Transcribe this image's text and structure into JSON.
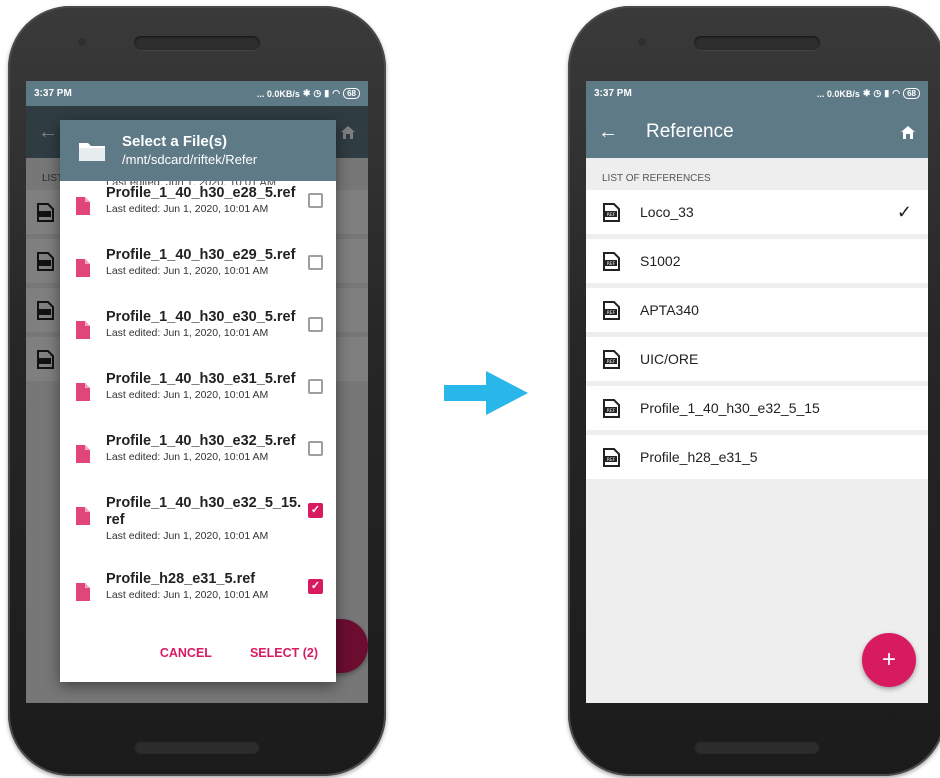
{
  "status_bar": {
    "time": "3:37 PM",
    "net_speed": "... 0.0KB/s",
    "battery": "68"
  },
  "colors": {
    "toolbar": "#5e7a86",
    "accent": "#d81b60",
    "background": "#eeeeee"
  },
  "left_phone": {
    "dialog": {
      "title": "Select a File(s)",
      "path": "/mnt/sdcard/riftek/Refer",
      "partial_row_text": "Last edited: Jun 1, 2020, 10:01 AM",
      "files": [
        {
          "name": "Profile_1_40_h30_e28_5.ref",
          "meta": "Last edited: Jun 1, 2020, 10:01 AM",
          "checked": false
        },
        {
          "name": "Profile_1_40_h30_e29_5.ref",
          "meta": "Last edited: Jun 1, 2020, 10:01 AM",
          "checked": false
        },
        {
          "name": "Profile_1_40_h30_e30_5.ref",
          "meta": "Last edited: Jun 1, 2020, 10:01 AM",
          "checked": false
        },
        {
          "name": "Profile_1_40_h30_e31_5.ref",
          "meta": "Last edited: Jun 1, 2020, 10:01 AM",
          "checked": false
        },
        {
          "name": "Profile_1_40_h30_e32_5.ref",
          "meta": "Last edited: Jun 1, 2020, 10:01 AM",
          "checked": false
        },
        {
          "name": "Profile_1_40_h30_e32_5_15.ref",
          "meta": "Last edited: Jun 1, 2020, 10:01 AM",
          "checked": true
        },
        {
          "name": "Profile_h28_e31_5.ref",
          "meta": "Last edited: Jun 1, 2020, 10:01 AM",
          "checked": true
        }
      ],
      "cancel_label": "CANCEL",
      "select_label": "SELECT (2)"
    },
    "background_label": "LIST"
  },
  "right_phone": {
    "toolbar_title": "Reference",
    "section_label": "LIST OF REFERENCES",
    "references": [
      {
        "label": "Loco_33",
        "selected": true
      },
      {
        "label": "S1002",
        "selected": false
      },
      {
        "label": "APTA340",
        "selected": false
      },
      {
        "label": "UIC/ORE",
        "selected": false
      },
      {
        "label": "Profile_1_40_h30_e32_5_15",
        "selected": false
      },
      {
        "label": "Profile_h28_e31_5",
        "selected": false
      }
    ],
    "fab_label": "+"
  },
  "icons": {
    "back": "arrow-left-icon",
    "home": "home-icon",
    "folder": "folder-icon",
    "file": "file-icon",
    "ref_file": "ref-file-icon",
    "check": "check-icon",
    "transition": "arrow-right-icon"
  }
}
